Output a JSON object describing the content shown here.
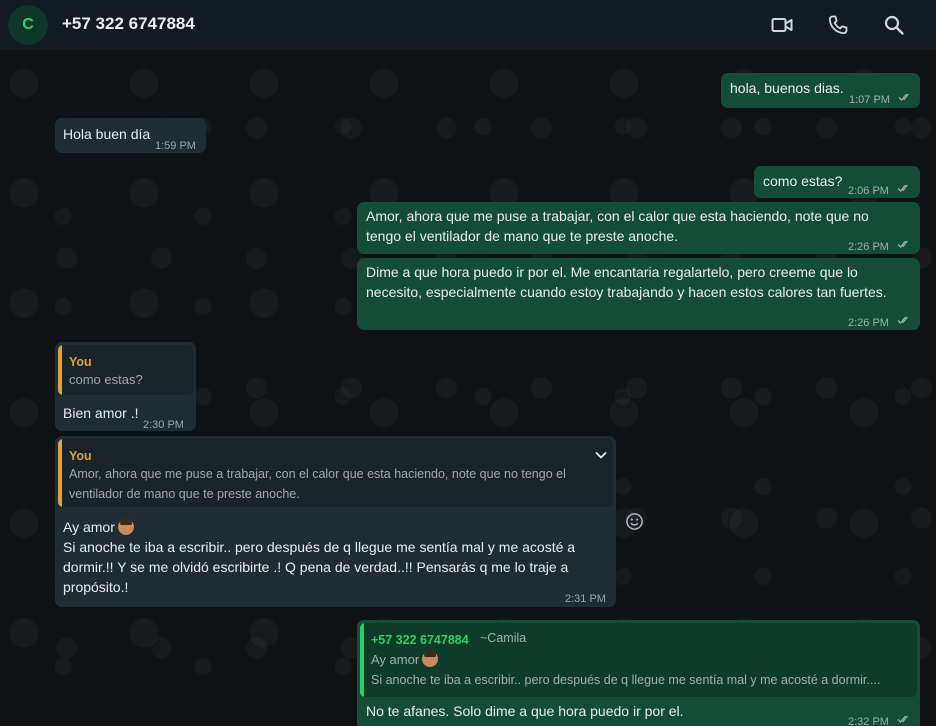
{
  "header": {
    "avatar_letter": "C",
    "contact_name": "+57 322 6747884"
  },
  "messages": {
    "m1": {
      "text": "hola, buenos dias.",
      "time": "1:07 PM"
    },
    "m2": {
      "text": "Hola buen día",
      "time": "1:59 PM"
    },
    "m3": {
      "text": "como estas?",
      "time": "2:06 PM"
    },
    "m4": {
      "line1": "Amor, ahora que me puse a trabajar, con el calor que esta haciendo, note que no",
      "line2": "tengo el ventilador de mano que te preste anoche.",
      "time": "2:26 PM"
    },
    "m5": {
      "line1": "Dime a que hora puedo ir por el. Me encantaria regalartelo, pero creeme que lo",
      "line2": "necesito, especialmente cuando estoy trabajando y hacen estos calores tan fuertes.",
      "time": "2:26 PM"
    },
    "m6": {
      "quote_author": "You",
      "quote_text": "como estas?",
      "text": "Bien amor .!",
      "time": "2:30 PM"
    },
    "m7": {
      "quote_author": "You",
      "quote_line1": "Amor, ahora que me puse a trabajar, con el calor que esta haciendo, note que no tengo el",
      "quote_line2": "ventilador de mano que te preste anoche.",
      "line1": "Ay amor",
      "line2": "Si anoche te iba a escribir.. pero después de q llegue me sentía mal y me acosté a",
      "line3": "dormir.!!  Y se me olvidó escribirte .! Q pena de verdad..!! Pensarás q me lo traje a",
      "line4": "propósito.!",
      "time": "2:31 PM"
    },
    "m8": {
      "quote_author": "+57 322 6747884",
      "quote_author_name": "~Camila",
      "quote_line1": "Ay amor",
      "quote_line2": "Si anoche te iba a escribir.. pero después de q llegue me sentía mal y me acosté a dormir....",
      "text": "No te afanes. Solo dime a que hora puedo ir por el.",
      "time": "2:32 PM"
    }
  },
  "colors": {
    "outgoing_bubble": "#144d37",
    "incoming_bubble": "#202c33",
    "accent_green": "#25d366",
    "quote_you": "#d9a43a"
  },
  "icons": [
    "video-call-icon",
    "voice-call-icon",
    "search-icon",
    "chevron-down-icon",
    "emoji-react-icon",
    "double-check-icon"
  ]
}
